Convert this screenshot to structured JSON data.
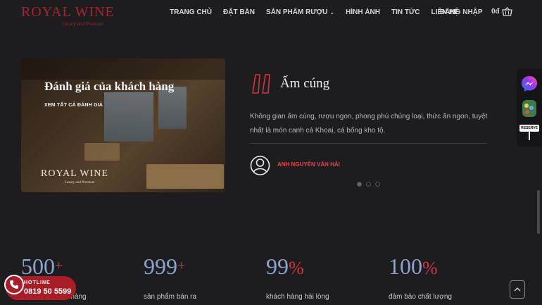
{
  "header": {
    "logo": {
      "word": "ROYAL WINE",
      "subtitle": "Luxury and Premium"
    },
    "nav": [
      {
        "label": "TRANG CHỦ"
      },
      {
        "label": "ĐẶT BÀN"
      },
      {
        "label": "SẢN PHẨM RƯỢU",
        "has_dropdown": true
      },
      {
        "label": "HÌNH ẢNH"
      },
      {
        "label": "TIN TỨC"
      },
      {
        "label": "LIÊN HỆ"
      }
    ],
    "login_label": "ĐĂNG NHẬP",
    "cart_total": "0đ",
    "cart_icon": "basket-icon"
  },
  "reviews": {
    "card_title": "Đánh giá của khách hàng",
    "see_all_label": "XEM TẤT CẢ ĐÁNH GIÁ",
    "card_logo": {
      "word": "ROYAL WINE",
      "subtitle": "Luxury and Premium"
    },
    "testimonial": {
      "title": "Ấm cúng",
      "text": "Không gian ấm cúng, rượu ngon, phong phú chủng loại, thức ăn ngon, tuyệt nhất là món canh cá Khoai, cá bống kho tộ.",
      "author": "ANH NGUYỄN VĂN HẢI"
    },
    "slide_count": 3,
    "active_slide": 1
  },
  "stats": [
    {
      "number": "500",
      "suffix": "+",
      "label": "...hàng"
    },
    {
      "number": "999",
      "suffix": "+",
      "label": "sản phẩm bán ra"
    },
    {
      "number": "99",
      "suffix": "%",
      "label": "khách hàng hài lòng"
    },
    {
      "number": "100",
      "suffix": "%",
      "label": "đảm bảo chất lượng"
    }
  ],
  "hotline": {
    "label": "HOTLINE",
    "number": "0819 50 5599"
  },
  "side_widgets": [
    "messenger-icon",
    "zalo-icon",
    "reserve-icon"
  ],
  "side_widget_text": "RESERVE",
  "colors": {
    "accent": "#d3343c",
    "stat_number": "#8aa4ce",
    "background": "#1d1d1f",
    "brand_red": "#a8232e"
  }
}
